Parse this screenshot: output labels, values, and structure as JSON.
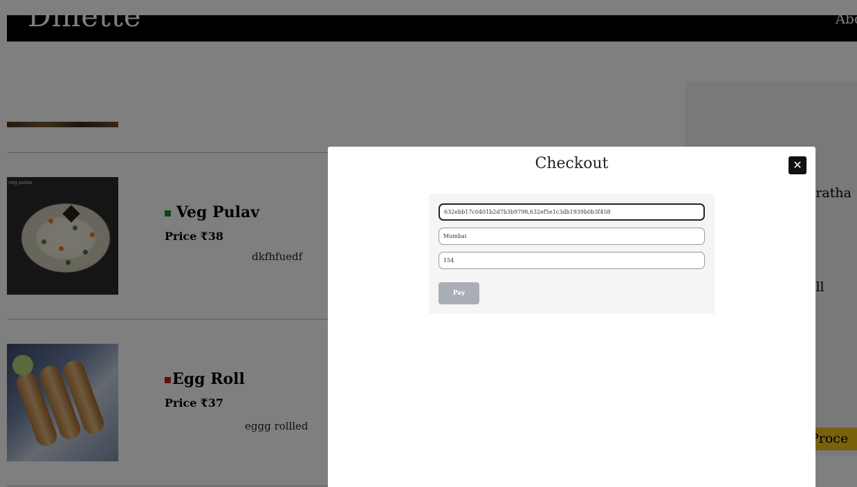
{
  "navbar": {
    "brand": "Dinette",
    "link": "Abo"
  },
  "menu": [
    {
      "name": "Veg Pulav",
      "type": "veg",
      "price_label": "Price",
      "price": "₹38",
      "description": "dkfhfuedf",
      "image_caption": "veg pulao"
    },
    {
      "name": "Egg Roll",
      "type": "nonveg",
      "price_label": "Price",
      "price": "₹37",
      "description": "eggg rollled"
    }
  ],
  "cart": {
    "items": [
      "aratha",
      "oll"
    ],
    "proceed_label": "Proce"
  },
  "checkout": {
    "title": "Checkout",
    "close_icon": "✕",
    "fields": {
      "ids_value": "632ebb17c0401b2d7b3b9798,632ef5e1c3db1939b0b3f458",
      "city_value": "Mumbai",
      "amount_value": "154"
    },
    "pay_label": "Pay"
  },
  "colors": {
    "veg_mark": "#1a8a2e",
    "nonveg_mark": "#cc1b1b",
    "proceed_bg": "#f2c21a",
    "pay_bg": "#a9aeb5"
  }
}
